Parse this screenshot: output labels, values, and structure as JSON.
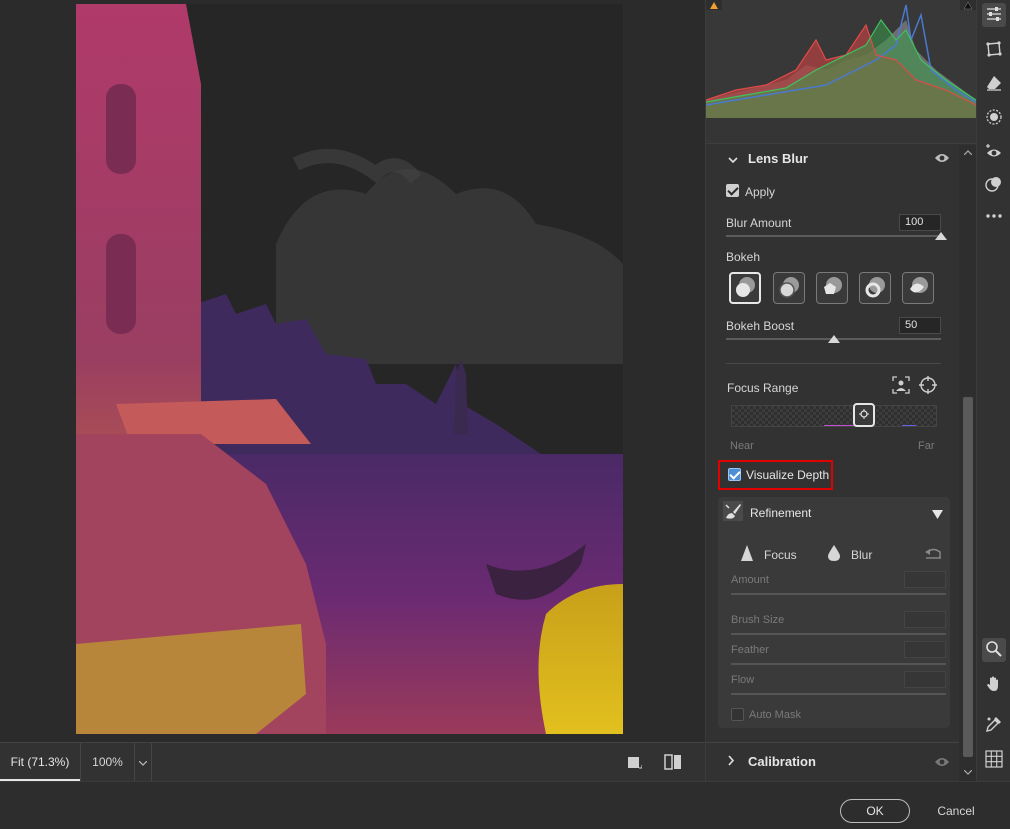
{
  "statusbar": {
    "zoom_fit": "Fit (71.3%)",
    "zoom_100": "100%"
  },
  "lens_blur": {
    "title": "Lens Blur",
    "apply_label": "Apply",
    "apply_checked": true,
    "blur_amount_label": "Blur Amount",
    "blur_amount_value": "100",
    "blur_amount_fraction": 1.0,
    "bokeh_label": "Bokeh",
    "bokeh_options": [
      "bokeh-circle",
      "bokeh-bubble",
      "bokeh-5-blade",
      "bokeh-ring",
      "bokeh-cat-eye"
    ],
    "bokeh_boost_label": "Bokeh Boost",
    "bokeh_boost_value": "50",
    "bokeh_boost_fraction": 0.5,
    "focus_range_label": "Focus Range",
    "near_label": "Near",
    "far_label": "Far",
    "visualize_depth_label": "Visualize Depth",
    "visualize_depth_checked": true
  },
  "refinement": {
    "title": "Refinement",
    "focus_label": "Focus",
    "blur_label": "Blur",
    "amount_label": "Amount",
    "brush_size_label": "Brush Size",
    "feather_label": "Feather",
    "flow_label": "Flow",
    "auto_mask_label": "Auto Mask"
  },
  "calibration": {
    "title": "Calibration"
  },
  "footer": {
    "ok_label": "OK",
    "cancel_label": "Cancel"
  },
  "colors": {
    "accent_blue": "#4d8fd6",
    "highlight_red": "#e00000",
    "panel_bg": "#323232"
  }
}
